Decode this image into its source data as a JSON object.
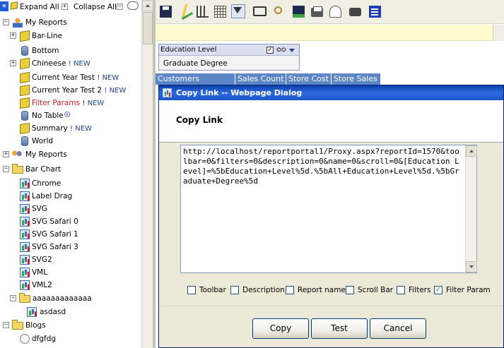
{
  "tree": {
    "expand_all": "Expand All",
    "collapse_all": "Collapse All",
    "nodes": [
      {
        "label": "My Reports"
      },
      {
        "label": "Bar-Line"
      },
      {
        "label": "Bottom"
      },
      {
        "label": "Chineese",
        "badge": "! NEW"
      },
      {
        "label": "Current Year Test",
        "badge": "! NEW"
      },
      {
        "label": "Current Year Test 2",
        "badge": "! NEW"
      },
      {
        "label": "Filter Params",
        "badge": "! NEW"
      },
      {
        "label": "No Table"
      },
      {
        "label": "Summary",
        "badge": "! NEW"
      },
      {
        "label": "World"
      },
      {
        "label": "My Reports"
      },
      {
        "label": "Bar Chart"
      },
      {
        "label": "Chrome"
      },
      {
        "label": "Label Drag"
      },
      {
        "label": "SVG"
      },
      {
        "label": "SVG Safari 0"
      },
      {
        "label": "SVG Safari 1"
      },
      {
        "label": "SVG Safari 3"
      },
      {
        "label": "SVG2"
      },
      {
        "label": "VML"
      },
      {
        "label": "VML2"
      },
      {
        "label": "aaaaaaaaaaaaa"
      },
      {
        "label": "asdasd"
      },
      {
        "label": "Blogs"
      },
      {
        "label": "dfgfdg"
      }
    ]
  },
  "filter": {
    "title": "Education Level",
    "value": "Graduate Degree"
  },
  "columns": [
    "Customers",
    "Sales Count",
    "Store Cost",
    "Store Sales"
  ],
  "dialog": {
    "window_title": "Copy Link -- Webpage Dialog",
    "heading": "Copy Link",
    "url": "http://localhost/reportportal1/Proxy.aspx?reportId=1570&toolbar=0&filters=0&description=0&name=0&scroll=0&[Education Level]=%5bEducation+Level%5d.%5bAll+Education+Level%5d.%5bGraduate+Degree%5d",
    "options": [
      {
        "label": "Toolbar",
        "checked": false
      },
      {
        "label": "Description",
        "checked": false
      },
      {
        "label": "Report name",
        "checked": false
      },
      {
        "label": "Scroll Bar",
        "checked": false
      },
      {
        "label": "Filters",
        "checked": false
      },
      {
        "label": "Filter Param",
        "checked": true
      }
    ],
    "buttons": {
      "copy": "Copy",
      "test": "Test",
      "cancel": "Cancel"
    }
  },
  "colors": {
    "accent": "#5c86c6",
    "title_bar": "#1c54c9",
    "new_badge": "#1f3f8f",
    "highlight_item": "#c8202a"
  }
}
